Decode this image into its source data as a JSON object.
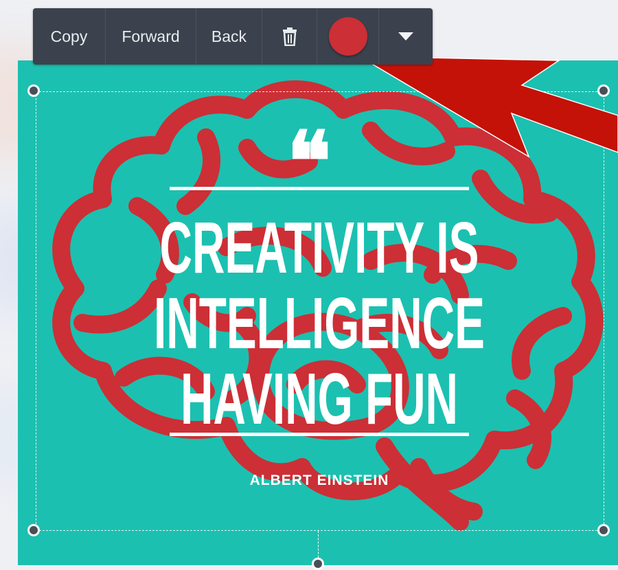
{
  "toolbar": {
    "copy_label": "Copy",
    "forward_label": "Forward",
    "back_label": "Back",
    "delete_icon": "trash-icon",
    "more_icon": "caret-down-icon",
    "selected_color": "#cc2f36"
  },
  "design": {
    "background_color": "#1cc0b0",
    "brain_color": "#cc2f36",
    "quote_mark": "❝",
    "quote_lines": [
      "CREATIVITY IS",
      "INTELLIGENCE",
      "HAVING FUN"
    ],
    "author": "ALBERT EINSTEIN"
  },
  "annotation": {
    "arrow_color": "#c41208",
    "arrow_icon": "pointer-arrow"
  }
}
